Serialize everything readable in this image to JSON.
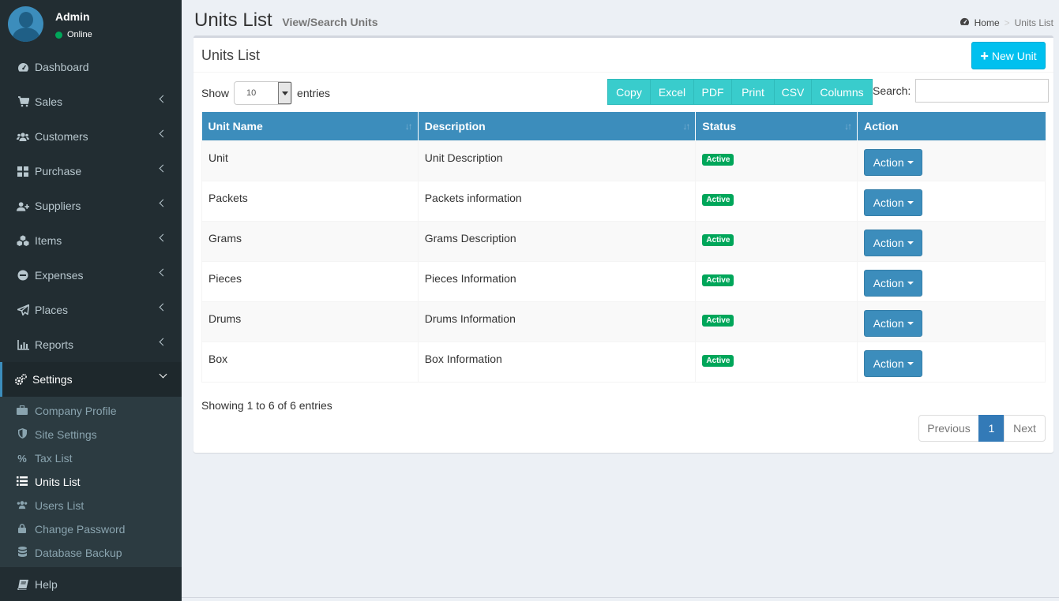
{
  "user": {
    "name": "Admin",
    "status": "Online"
  },
  "sidebar": {
    "items": [
      {
        "label": "Dashboard",
        "icon": "dashboard-icon"
      },
      {
        "label": "Sales",
        "icon": "cart-icon"
      },
      {
        "label": "Customers",
        "icon": "users-icon"
      },
      {
        "label": "Purchase",
        "icon": "grid-icon"
      },
      {
        "label": "Suppliers",
        "icon": "user-plus-icon"
      },
      {
        "label": "Items",
        "icon": "cubes-icon"
      },
      {
        "label": "Expenses",
        "icon": "minus-circle-icon"
      },
      {
        "label": "Places",
        "icon": "paper-plane-icon"
      },
      {
        "label": "Reports",
        "icon": "bar-chart-icon"
      },
      {
        "label": "Settings",
        "icon": "gears-icon"
      }
    ],
    "settings_sub": [
      {
        "label": "Company Profile",
        "icon": "briefcase-icon"
      },
      {
        "label": "Site Settings",
        "icon": "shield-icon"
      },
      {
        "label": "Tax List",
        "icon": "percent-icon"
      },
      {
        "label": "Units List",
        "icon": "list-icon"
      },
      {
        "label": "Users List",
        "icon": "users-icon"
      },
      {
        "label": "Change Password",
        "icon": "lock-icon"
      },
      {
        "label": "Database Backup",
        "icon": "database-icon"
      }
    ],
    "help": {
      "label": "Help",
      "icon": "book-icon"
    }
  },
  "header": {
    "title": "Units List",
    "subtitle": "View/Search Units",
    "breadcrumb_home": "Home",
    "breadcrumb_current": "Units List"
  },
  "box": {
    "title": "Units List",
    "new_button": "New Unit"
  },
  "controls": {
    "show_label": "Show",
    "entries_value": "10",
    "entries_label": "entries",
    "search_label": "Search:",
    "search_value": "",
    "export_buttons": [
      "Copy",
      "Excel",
      "PDF",
      "Print",
      "CSV",
      "Columns"
    ]
  },
  "table": {
    "headers": [
      "Unit Name",
      "Description",
      "Status",
      "Action"
    ],
    "rows": [
      {
        "name": "Unit",
        "description": "Unit Description",
        "status": "Active",
        "action": "Action"
      },
      {
        "name": "Packets",
        "description": "Packets information",
        "status": "Active",
        "action": "Action"
      },
      {
        "name": "Grams",
        "description": "Grams Description",
        "status": "Active",
        "action": "Action"
      },
      {
        "name": "Pieces",
        "description": "Pieces Information",
        "status": "Active",
        "action": "Action"
      },
      {
        "name": "Drums",
        "description": "Drums Information",
        "status": "Active",
        "action": "Action"
      },
      {
        "name": "Box",
        "description": "Box Information",
        "status": "Active",
        "action": "Action"
      }
    ]
  },
  "footer": {
    "info": "Showing 1 to 6 of 6 entries",
    "prev": "Previous",
    "page": "1",
    "next": "Next"
  },
  "colors": {
    "sidebar_bg": "#222d32",
    "primary": "#3c8dbc",
    "info": "#00c0ef",
    "teal": "#39cccc",
    "success": "#00a65a"
  }
}
